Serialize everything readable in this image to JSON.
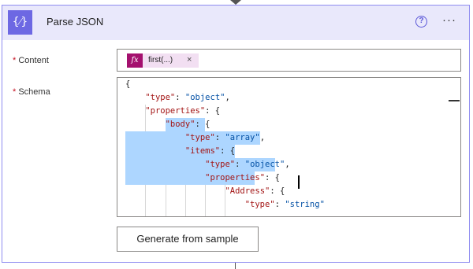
{
  "action": {
    "title": "Parse JSON",
    "icon": "braces-icon",
    "icon_glyph": "{⁄}",
    "help_glyph": "?",
    "more_glyph": "···"
  },
  "fields": {
    "content": {
      "required_mark": "*",
      "label": "Content",
      "token": {
        "icon_glyph": "fx",
        "label": "first(...)",
        "remove_glyph": "×"
      }
    },
    "schema": {
      "required_mark": "*",
      "label": "Schema",
      "lines": [
        "{",
        "    \"type\": \"object\",",
        "    \"properties\": {",
        "        \"body\": {",
        "            \"type\": \"array\",",
        "            \"items\": {",
        "                \"type\": \"object\",",
        "                \"properties\": {",
        "                    \"Address\": {",
        "                        \"type\": \"string\""
      ]
    }
  },
  "buttons": {
    "generate_label": "Generate from sample"
  },
  "colors": {
    "accent": "#6d68e3",
    "header_bg": "#e9e8fb",
    "card_border": "#8f8cf0",
    "token_bg": "#f2dff2",
    "token_icon_bg": "#a4106e",
    "selection": "#add6ff",
    "json_key": "#a31515",
    "json_string": "#0451a5"
  }
}
